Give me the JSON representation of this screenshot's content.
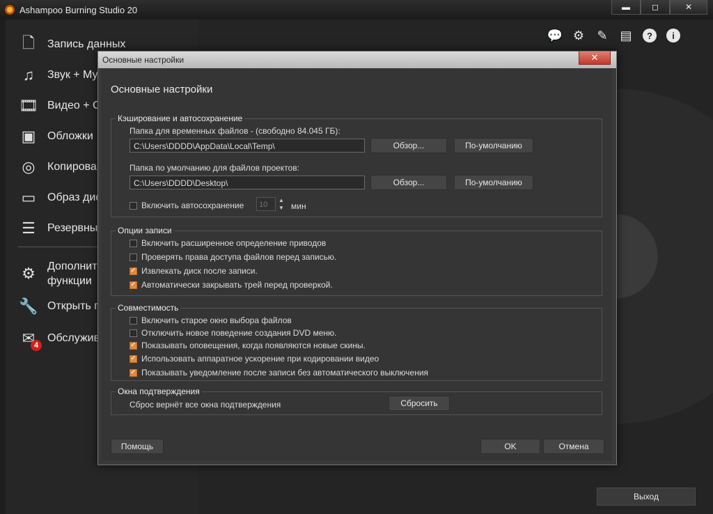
{
  "window": {
    "title": "Ashampoo Burning Studio 20",
    "minimize": "▬",
    "maximize": "◻",
    "close": "✕"
  },
  "sidebar": {
    "items": [
      {
        "label": "Запись данных",
        "icon": "file-icon",
        "glyph": "🗋"
      },
      {
        "label": "Звук + Му",
        "icon": "music-note-icon",
        "glyph": "♫"
      },
      {
        "label": "Видео + С",
        "icon": "film-strip-icon",
        "glyph": "🎞"
      },
      {
        "label": "Обложки",
        "icon": "cover-icon",
        "glyph": "▣"
      },
      {
        "label": "Копирова",
        "icon": "discs-icon",
        "glyph": "◎"
      },
      {
        "label": "Образ дис",
        "icon": "disc-image-icon",
        "glyph": "▭"
      },
      {
        "label": "Резервны",
        "icon": "database-icon",
        "glyph": "☰"
      },
      {
        "label": "Дополнит\nфункции",
        "icon": "gears-icon",
        "glyph": "⚙"
      },
      {
        "label": "Открыть п",
        "icon": "wrench-file-icon",
        "glyph": "🔧"
      },
      {
        "label": "Обслужив",
        "icon": "service-icon",
        "glyph": "✉",
        "badge": "4"
      }
    ]
  },
  "toolbar": {
    "icons": [
      "feedback-icon",
      "settings-gear-icon",
      "pin-icon",
      "comment-icon",
      "help-icon",
      "info-icon"
    ],
    "help": "?",
    "info": "i"
  },
  "exit_button": "Выход",
  "dialog": {
    "window_title": "Основные настройки",
    "heading": "Основные настройки",
    "close": "✕",
    "caching": {
      "title": "Кэширование и автосохранение",
      "temp_label": "Папка для временных файлов - (свободно 84.045  ГБ):",
      "temp_value": "C:\\Users\\DDDD\\AppData\\Local\\Temp\\",
      "project_label": "Папка по умолчанию для файлов проектов:",
      "project_value": "C:\\Users\\DDDD\\Desktop\\",
      "browse": "Обзор...",
      "default": "По-умолчанию",
      "autosave_label": "Включить автосохранение",
      "autosave_checked": false,
      "autosave_minutes": "10",
      "minutes_unit": "мин"
    },
    "record_options": {
      "title": "Опции записи",
      "items": [
        {
          "label": "Включить расширенное определение приводов",
          "checked": false
        },
        {
          "label": "Проверять права доступа файлов перед записью.",
          "checked": false
        },
        {
          "label": "Извлекать диск после записи.",
          "checked": true
        },
        {
          "label": "Автоматически закрывать трей перед проверкой.",
          "checked": true
        }
      ]
    },
    "compat": {
      "title": "Совместимость",
      "items": [
        {
          "label": "Включить старое окно выбора файлов",
          "checked": false
        },
        {
          "label": "Отключить новое поведение создания DVD меню.",
          "checked": false
        },
        {
          "label": "Показывать оповещения, когда появляются новые скины.",
          "checked": true
        },
        {
          "label": "Использовать аппаратное ускорение при кодировании видео",
          "checked": true
        },
        {
          "label": "Показывать уведомление после записи без автоматического выключения",
          "checked": true
        }
      ]
    },
    "confirm": {
      "title": "Окна подтверждения",
      "text": "Сброс вернёт все окна подтверждения",
      "reset": "Сбросить"
    },
    "help_button": "Помощь",
    "ok_button": "OK",
    "cancel_button": "Отмена"
  }
}
